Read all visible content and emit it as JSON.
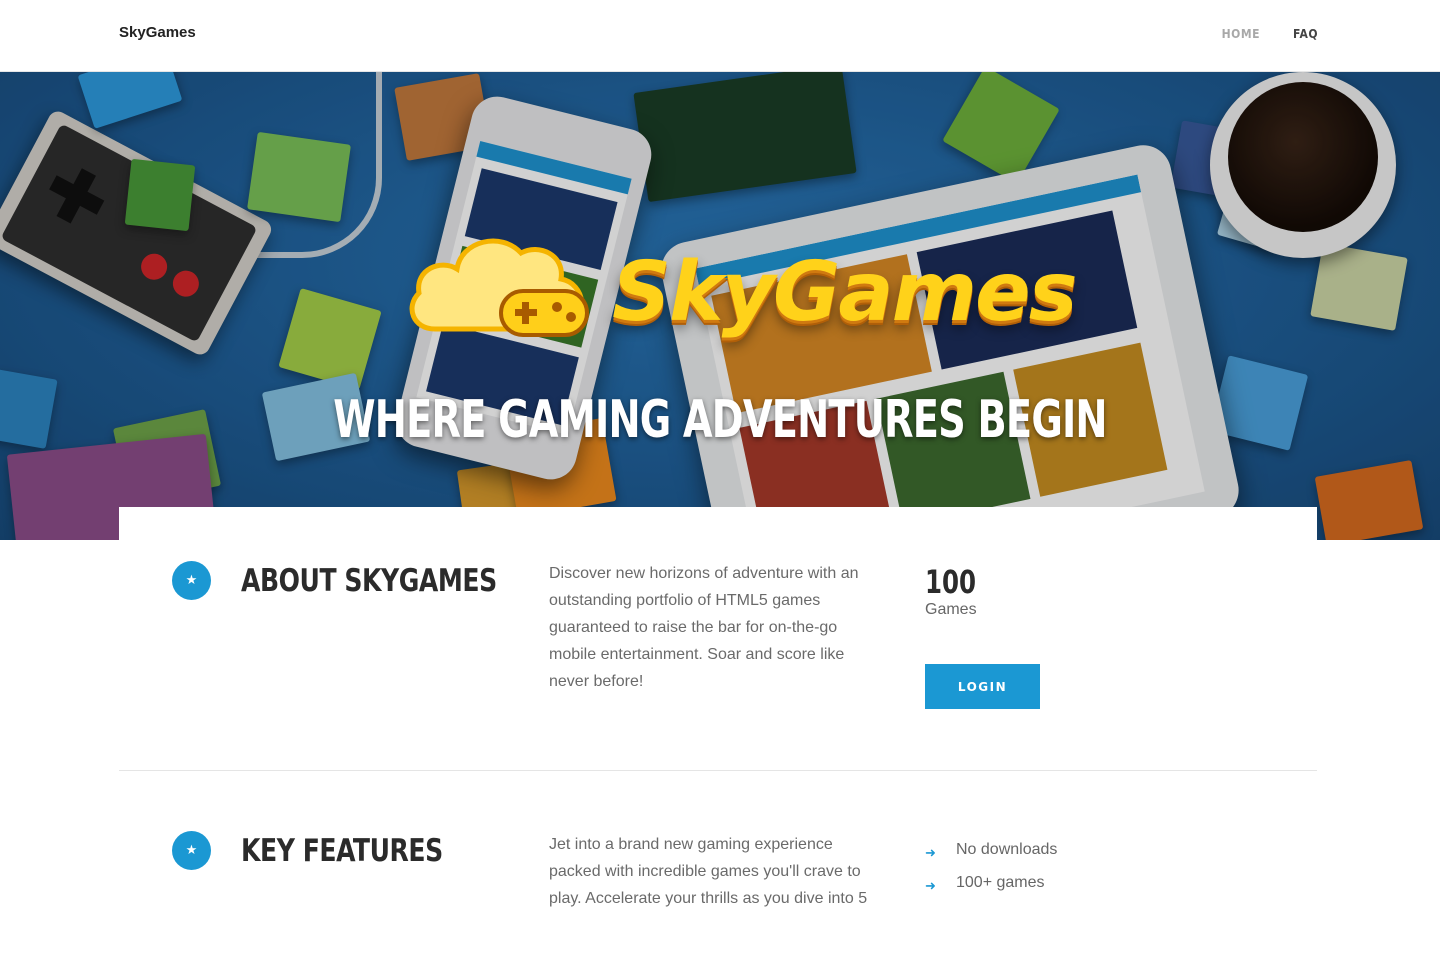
{
  "header": {
    "brand": "SkyGames",
    "nav": [
      {
        "label": "HOME"
      },
      {
        "label": "FAQ"
      }
    ]
  },
  "hero": {
    "logo_text": "SkyGames",
    "title": "WHERE GAMING ADVENTURES BEGIN"
  },
  "about": {
    "icon": "star-icon",
    "title": "ABOUT SKYGAMES",
    "text": "Discover new horizons of adventure with an outstanding portfolio of HTML5 games guaranteed to raise the bar for on-the-go mobile entertainment. Soar and score like never before!",
    "stat_value": "100",
    "stat_label": "Games",
    "login_label": "LOGIN"
  },
  "features": {
    "icon": "star-icon",
    "title": "KEY FEATURES",
    "text": "Jet into a brand new gaming experience packed with incredible games you'll crave to play. Accelerate your thrills as you dive into 5",
    "items": [
      "No downloads",
      "100+ games"
    ]
  },
  "colors": {
    "accent": "#1b98d3",
    "hero_bg": "#1f5f99",
    "logo_yellow": "#ffd21a"
  }
}
